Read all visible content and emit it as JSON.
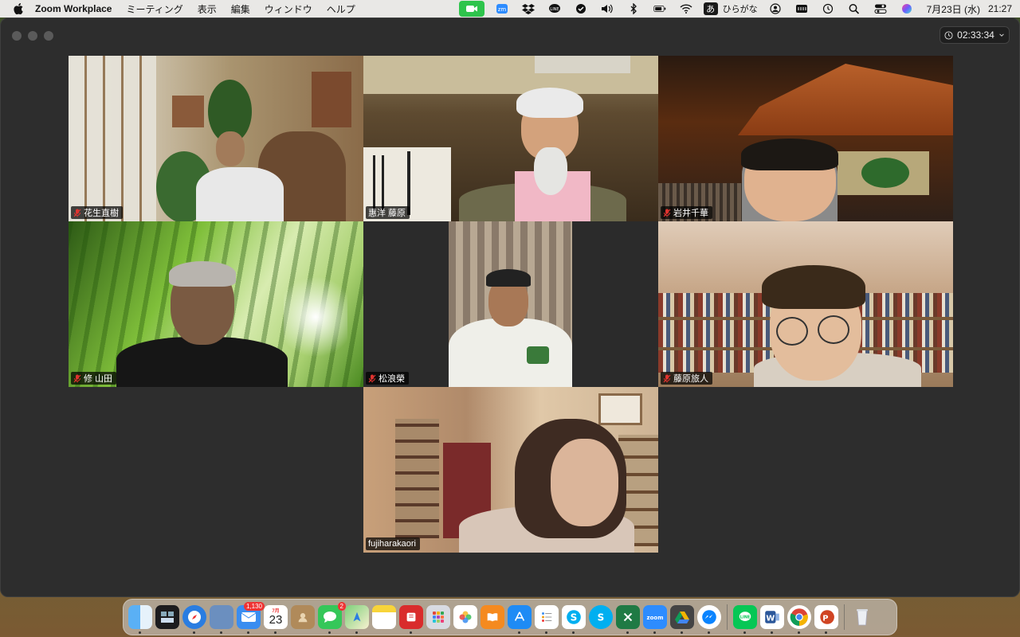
{
  "menubar": {
    "app_name": "Zoom Workplace",
    "menus": [
      "ミーティング",
      "表示",
      "編集",
      "ウィンドウ",
      "ヘルプ"
    ],
    "input_mode_icon": "あ",
    "input_mode_label": "ひらがな",
    "date": "7月23日 (水)",
    "time": "21:27"
  },
  "window": {
    "meeting_timer": "02:33:34"
  },
  "participants": [
    {
      "name": "花生直樹",
      "muted": true
    },
    {
      "name": "惠洋 藤原",
      "muted": false
    },
    {
      "name": "岩井千華",
      "muted": true
    },
    {
      "name": "修 山田",
      "muted": true
    },
    {
      "name": "松浪榮",
      "muted": true
    },
    {
      "name": "藤原旅人",
      "muted": true
    },
    {
      "name": "fujiharakaori",
      "muted": false,
      "active_speaker": true
    }
  ],
  "dock": {
    "badges": {
      "mail": "1,130",
      "messages": "2"
    },
    "calendar_month": "7月",
    "calendar_day": "23",
    "apps": [
      "finder",
      "mission-control",
      "safari",
      "preview",
      "mail",
      "calendar",
      "contacts",
      "messages",
      "maps",
      "notes",
      "flashcard",
      "launchpad",
      "photos",
      "books",
      "app-store",
      "reminders",
      "skype-1",
      "skype-2",
      "excel",
      "zoom",
      "drive",
      "messenger",
      "line",
      "word",
      "chrome",
      "powerpoint",
      "trash"
    ]
  },
  "colors": {
    "window_bg": "#2d2d2d",
    "active_speaker_border": "#39c34a",
    "muted_icon": "#e0332f"
  }
}
